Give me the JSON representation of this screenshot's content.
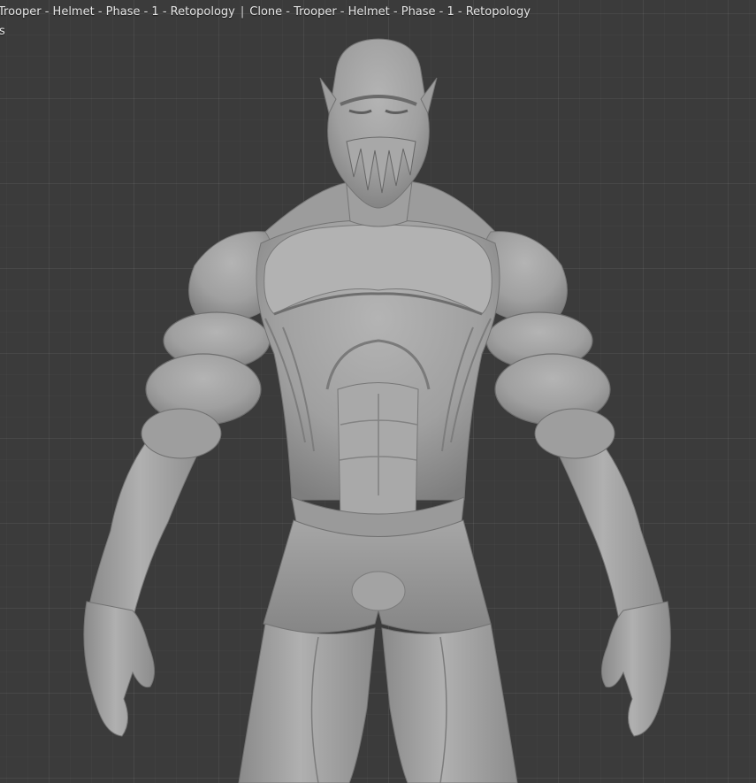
{
  "viewport": {
    "object_text": "Trooper - Helmet - Phase - 1 - Retopology",
    "mesh_text": "Clone - Trooper - Helmet - Phase - 1 - Retopology",
    "separator": "|",
    "sub_text": "s",
    "background_color": "#3b3b3b",
    "model_color": "#9a9a9a"
  }
}
